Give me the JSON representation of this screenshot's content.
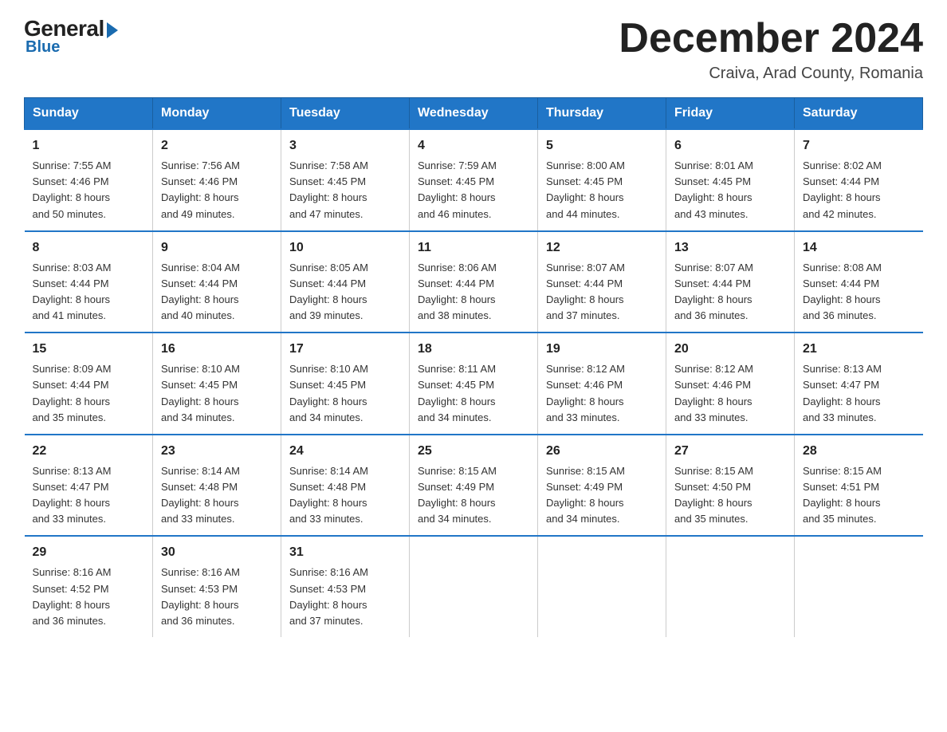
{
  "logo": {
    "general": "General",
    "blue": "Blue"
  },
  "title": "December 2024",
  "location": "Craiva, Arad County, Romania",
  "weekdays": [
    "Sunday",
    "Monday",
    "Tuesday",
    "Wednesday",
    "Thursday",
    "Friday",
    "Saturday"
  ],
  "weeks": [
    [
      {
        "day": "1",
        "info": "Sunrise: 7:55 AM\nSunset: 4:46 PM\nDaylight: 8 hours\nand 50 minutes."
      },
      {
        "day": "2",
        "info": "Sunrise: 7:56 AM\nSunset: 4:46 PM\nDaylight: 8 hours\nand 49 minutes."
      },
      {
        "day": "3",
        "info": "Sunrise: 7:58 AM\nSunset: 4:45 PM\nDaylight: 8 hours\nand 47 minutes."
      },
      {
        "day": "4",
        "info": "Sunrise: 7:59 AM\nSunset: 4:45 PM\nDaylight: 8 hours\nand 46 minutes."
      },
      {
        "day": "5",
        "info": "Sunrise: 8:00 AM\nSunset: 4:45 PM\nDaylight: 8 hours\nand 44 minutes."
      },
      {
        "day": "6",
        "info": "Sunrise: 8:01 AM\nSunset: 4:45 PM\nDaylight: 8 hours\nand 43 minutes."
      },
      {
        "day": "7",
        "info": "Sunrise: 8:02 AM\nSunset: 4:44 PM\nDaylight: 8 hours\nand 42 minutes."
      }
    ],
    [
      {
        "day": "8",
        "info": "Sunrise: 8:03 AM\nSunset: 4:44 PM\nDaylight: 8 hours\nand 41 minutes."
      },
      {
        "day": "9",
        "info": "Sunrise: 8:04 AM\nSunset: 4:44 PM\nDaylight: 8 hours\nand 40 minutes."
      },
      {
        "day": "10",
        "info": "Sunrise: 8:05 AM\nSunset: 4:44 PM\nDaylight: 8 hours\nand 39 minutes."
      },
      {
        "day": "11",
        "info": "Sunrise: 8:06 AM\nSunset: 4:44 PM\nDaylight: 8 hours\nand 38 minutes."
      },
      {
        "day": "12",
        "info": "Sunrise: 8:07 AM\nSunset: 4:44 PM\nDaylight: 8 hours\nand 37 minutes."
      },
      {
        "day": "13",
        "info": "Sunrise: 8:07 AM\nSunset: 4:44 PM\nDaylight: 8 hours\nand 36 minutes."
      },
      {
        "day": "14",
        "info": "Sunrise: 8:08 AM\nSunset: 4:44 PM\nDaylight: 8 hours\nand 36 minutes."
      }
    ],
    [
      {
        "day": "15",
        "info": "Sunrise: 8:09 AM\nSunset: 4:44 PM\nDaylight: 8 hours\nand 35 minutes."
      },
      {
        "day": "16",
        "info": "Sunrise: 8:10 AM\nSunset: 4:45 PM\nDaylight: 8 hours\nand 34 minutes."
      },
      {
        "day": "17",
        "info": "Sunrise: 8:10 AM\nSunset: 4:45 PM\nDaylight: 8 hours\nand 34 minutes."
      },
      {
        "day": "18",
        "info": "Sunrise: 8:11 AM\nSunset: 4:45 PM\nDaylight: 8 hours\nand 34 minutes."
      },
      {
        "day": "19",
        "info": "Sunrise: 8:12 AM\nSunset: 4:46 PM\nDaylight: 8 hours\nand 33 minutes."
      },
      {
        "day": "20",
        "info": "Sunrise: 8:12 AM\nSunset: 4:46 PM\nDaylight: 8 hours\nand 33 minutes."
      },
      {
        "day": "21",
        "info": "Sunrise: 8:13 AM\nSunset: 4:47 PM\nDaylight: 8 hours\nand 33 minutes."
      }
    ],
    [
      {
        "day": "22",
        "info": "Sunrise: 8:13 AM\nSunset: 4:47 PM\nDaylight: 8 hours\nand 33 minutes."
      },
      {
        "day": "23",
        "info": "Sunrise: 8:14 AM\nSunset: 4:48 PM\nDaylight: 8 hours\nand 33 minutes."
      },
      {
        "day": "24",
        "info": "Sunrise: 8:14 AM\nSunset: 4:48 PM\nDaylight: 8 hours\nand 33 minutes."
      },
      {
        "day": "25",
        "info": "Sunrise: 8:15 AM\nSunset: 4:49 PM\nDaylight: 8 hours\nand 34 minutes."
      },
      {
        "day": "26",
        "info": "Sunrise: 8:15 AM\nSunset: 4:49 PM\nDaylight: 8 hours\nand 34 minutes."
      },
      {
        "day": "27",
        "info": "Sunrise: 8:15 AM\nSunset: 4:50 PM\nDaylight: 8 hours\nand 35 minutes."
      },
      {
        "day": "28",
        "info": "Sunrise: 8:15 AM\nSunset: 4:51 PM\nDaylight: 8 hours\nand 35 minutes."
      }
    ],
    [
      {
        "day": "29",
        "info": "Sunrise: 8:16 AM\nSunset: 4:52 PM\nDaylight: 8 hours\nand 36 minutes."
      },
      {
        "day": "30",
        "info": "Sunrise: 8:16 AM\nSunset: 4:53 PM\nDaylight: 8 hours\nand 36 minutes."
      },
      {
        "day": "31",
        "info": "Sunrise: 8:16 AM\nSunset: 4:53 PM\nDaylight: 8 hours\nand 37 minutes."
      },
      {
        "day": "",
        "info": ""
      },
      {
        "day": "",
        "info": ""
      },
      {
        "day": "",
        "info": ""
      },
      {
        "day": "",
        "info": ""
      }
    ]
  ]
}
